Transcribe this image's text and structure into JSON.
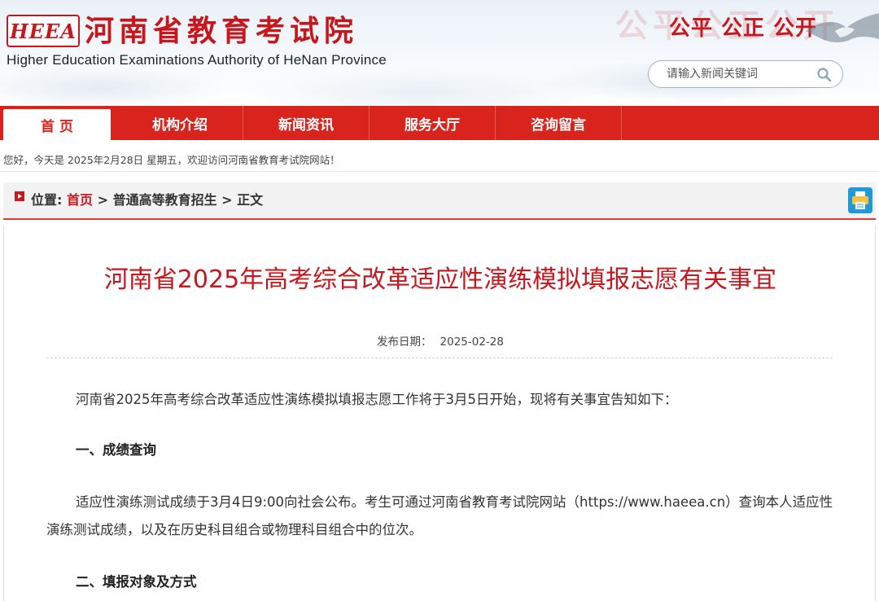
{
  "header": {
    "logo_text": "HEEA",
    "title": "河南省教育考试院",
    "subtitle": "Higher Education Examinations Authority of HeNan Province",
    "slogan": "公平 公正 公开",
    "slogan_ghost": "公平公正公开",
    "search": {
      "placeholder": "请输入新闻关键词",
      "icon": "search-icon"
    }
  },
  "nav": {
    "items": [
      {
        "label": "首 页",
        "active": true
      },
      {
        "label": "机构介绍",
        "active": false
      },
      {
        "label": "新闻资讯",
        "active": false
      },
      {
        "label": "服务大厅",
        "active": false
      },
      {
        "label": "咨询留言",
        "active": false
      }
    ]
  },
  "welcome": "您好，今天是 2025年2月28日 星期五，欢迎访问河南省教育考试院网站！",
  "location": {
    "prefix": "位置:",
    "home": "首页",
    "separator": ">",
    "category": "普通高等教育招生",
    "current": "正文",
    "print_icon": "print-icon"
  },
  "article": {
    "title": "河南省2025年高考综合改革适应性演练模拟填报志愿有关事宜",
    "date_label": "发布日期：",
    "date_value": "2025-02-28",
    "intro": "河南省2025年高考综合改革适应性演练模拟填报志愿工作将于3月5日开始，现将有关事宜告知如下：",
    "section1_heading": "一、成绩查询",
    "section1_body": "适应性演练测试成绩于3月4日9:00向社会公布。考生可通过河南省教育考试院网站（https://www.haeea.cn）查询本人适应性演练测试成绩，以及在历史科目组合或物理科目组合中的位次。",
    "section2_heading": "二、填报对象及方式"
  },
  "colors": {
    "brand_red": "#c8161d",
    "nav_red": "#d8241c",
    "print_blue": "#1a8fd2"
  }
}
